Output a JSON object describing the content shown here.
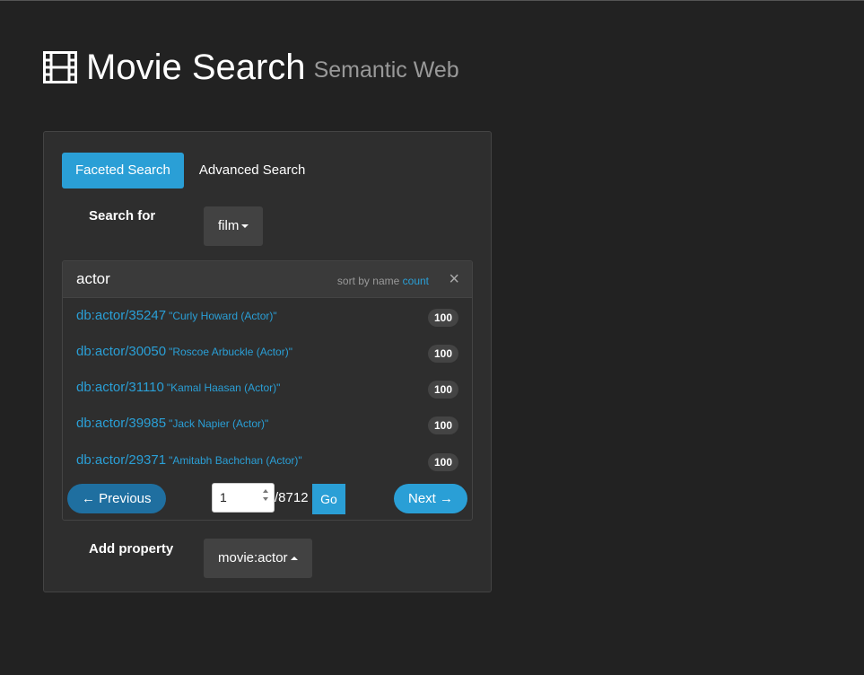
{
  "header": {
    "title": "Movie Search",
    "subtitle": "Semantic Web"
  },
  "tabs": [
    {
      "label": "Faceted Search",
      "active": true
    },
    {
      "label": "Advanced Search",
      "active": false
    }
  ],
  "search_for": {
    "label": "Search for",
    "selected": "film"
  },
  "facet": {
    "title": "actor",
    "sort_prefix": "sort by name",
    "sort_count": "count",
    "close": "×",
    "rows": [
      {
        "id": "db:actor/35247",
        "name": "\"Curly Howard (Actor)\"",
        "count": "100"
      },
      {
        "id": "db:actor/30050",
        "name": "\"Roscoe Arbuckle (Actor)\"",
        "count": "100"
      },
      {
        "id": "db:actor/31110",
        "name": "\"Kamal Haasan (Actor)\"",
        "count": "100"
      },
      {
        "id": "db:actor/39985",
        "name": "\"Jack Napier (Actor)\"",
        "count": "100"
      },
      {
        "id": "db:actor/29371",
        "name": "\"Amitabh Bachchan (Actor)\"",
        "count": "100"
      }
    ],
    "pager": {
      "prev": "← Previous",
      "page": "1",
      "total": "/8712",
      "go": "Go",
      "next": "Next →"
    }
  },
  "add_property": {
    "label": "Add property",
    "selected": "movie:actor"
  },
  "colors": {
    "accent": "#2a9fd6",
    "background": "#222222",
    "panel": "#2e2e2e"
  }
}
